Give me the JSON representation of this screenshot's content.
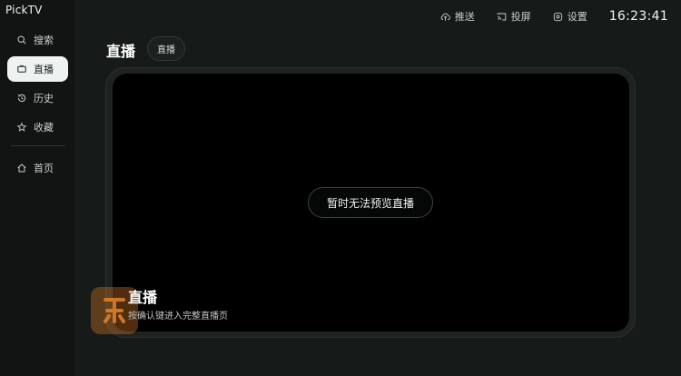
{
  "app": {
    "title": "PickTV"
  },
  "sidebar": {
    "items": [
      {
        "label": "搜索",
        "icon": "search-icon"
      },
      {
        "label": "直播",
        "icon": "live-tv-icon",
        "active": true
      },
      {
        "label": "历史",
        "icon": "history-icon"
      },
      {
        "label": "收藏",
        "icon": "star-icon"
      }
    ],
    "home": {
      "label": "首页",
      "icon": "home-icon"
    }
  },
  "topbar": {
    "push_label": "推送",
    "cast_label": "投屏",
    "settings_label": "设置",
    "clock": "16:23:41"
  },
  "main": {
    "title": "直播",
    "chip_label": "直播",
    "preview_message": "暂时无法预览直播",
    "card_title": "直播",
    "card_subtitle": "按确认键进入完整直播页"
  },
  "colors": {
    "background": "#161a18",
    "sidebar": "#111413",
    "active_item": "#eef3f1",
    "player": "#000000",
    "watermark": "#e68228"
  }
}
